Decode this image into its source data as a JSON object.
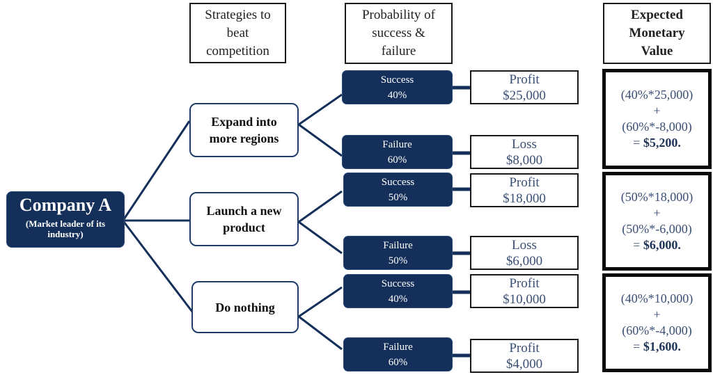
{
  "colors": {
    "navy": "#14305a",
    "text_blue": "#3b4f75",
    "border_dark": "#1a1a1a"
  },
  "headers": {
    "strategies": [
      "Strategies to",
      "beat",
      "competition"
    ],
    "probability": [
      "Probability of",
      "success &",
      "failure"
    ],
    "emv": [
      "Expected",
      "Monetary",
      "Value"
    ]
  },
  "root": {
    "title": "Company A",
    "subtitle_line1": "(Market leader of its",
    "subtitle_line2": "industry)"
  },
  "strategies": [
    {
      "line1": "Expand into",
      "line2": "more regions",
      "outcomes": [
        {
          "label": "Success",
          "prob": "40%",
          "result": "Profit",
          "amount": "$25,000"
        },
        {
          "label": "Failure",
          "prob": "60%",
          "result": "Loss",
          "amount": "$8,000"
        }
      ],
      "emv": {
        "term1": "(40%*25,000)",
        "plus": "+",
        "term2": "(60%*-8,000)",
        "eq": "= ",
        "result": "$5,200."
      }
    },
    {
      "line1": "Launch a new",
      "line2": "product",
      "outcomes": [
        {
          "label": "Success",
          "prob": "50%",
          "result": "Profit",
          "amount": "$18,000"
        },
        {
          "label": "Failure",
          "prob": "50%",
          "result": "Loss",
          "amount": "$6,000"
        }
      ],
      "emv": {
        "term1": "(50%*18,000)",
        "plus": "+",
        "term2": "(50%*-6,000)",
        "eq": "= ",
        "result": "$6,000."
      }
    },
    {
      "line1": "Do nothing",
      "line2": "",
      "outcomes": [
        {
          "label": "Success",
          "prob": "40%",
          "result": "Profit",
          "amount": "$10,000"
        },
        {
          "label": "Failure",
          "prob": "60%",
          "result": "Profit",
          "amount": "$4,000"
        }
      ],
      "emv": {
        "term1": "(40%*10,000)",
        "plus": "+",
        "term2": "(60%*-4,000)",
        "eq": "= ",
        "result": "$1,600."
      }
    }
  ]
}
